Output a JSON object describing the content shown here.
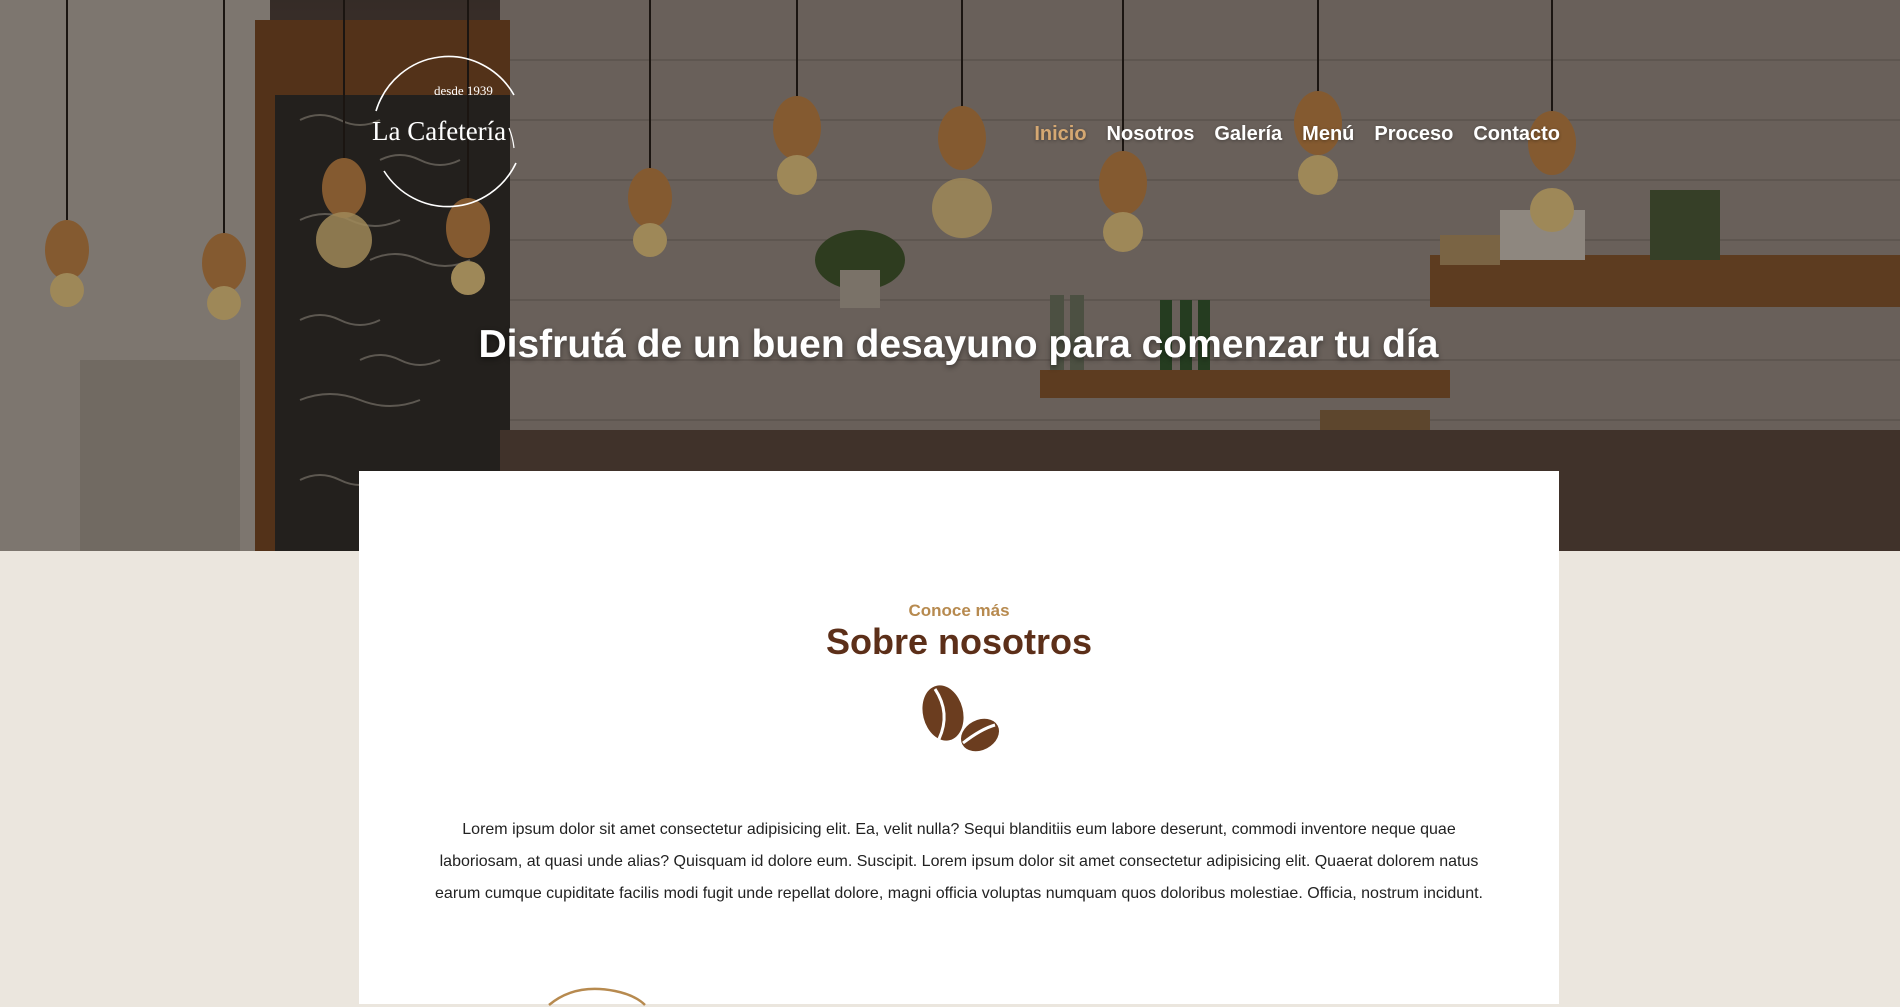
{
  "brand": {
    "year_text": "desde 1939",
    "name": "La Cafetería"
  },
  "nav": {
    "items": [
      {
        "label": "Inicio",
        "active": true
      },
      {
        "label": "Nosotros",
        "active": false
      },
      {
        "label": "Galería",
        "active": false
      },
      {
        "label": "Menú",
        "active": false
      },
      {
        "label": "Proceso",
        "active": false
      },
      {
        "label": "Contacto",
        "active": false
      }
    ],
    "active_color": "#d5a872"
  },
  "hero": {
    "headline": "Disfrutá de un buen desayuno para comenzar tu día"
  },
  "about": {
    "eyebrow": "Conoce más",
    "title": "Sobre nosotros",
    "icon": "coffee-beans-icon",
    "text": "Lorem ipsum dolor sit amet consectetur adipisicing elit. Ea, velit nulla? Sequi blanditiis eum labore deserunt, commodi inventore neque quae laboriosam, at quasi unde alias? Quisquam id dolore eum. Suscipit. Lorem ipsum dolor sit amet consectetur adipisicing elit. Quaerat dolorem natus earum cumque cupiditate facilis modi fugit unde repellat dolore, magni officia voluptas numquam quos doloribus molestiae. Officia, nostrum incidunt."
  },
  "colors": {
    "page_background": "#ebe6de",
    "accent": "#b78a4f",
    "title_brown": "#5c2f19",
    "icon_brown": "#6b3d1f"
  }
}
